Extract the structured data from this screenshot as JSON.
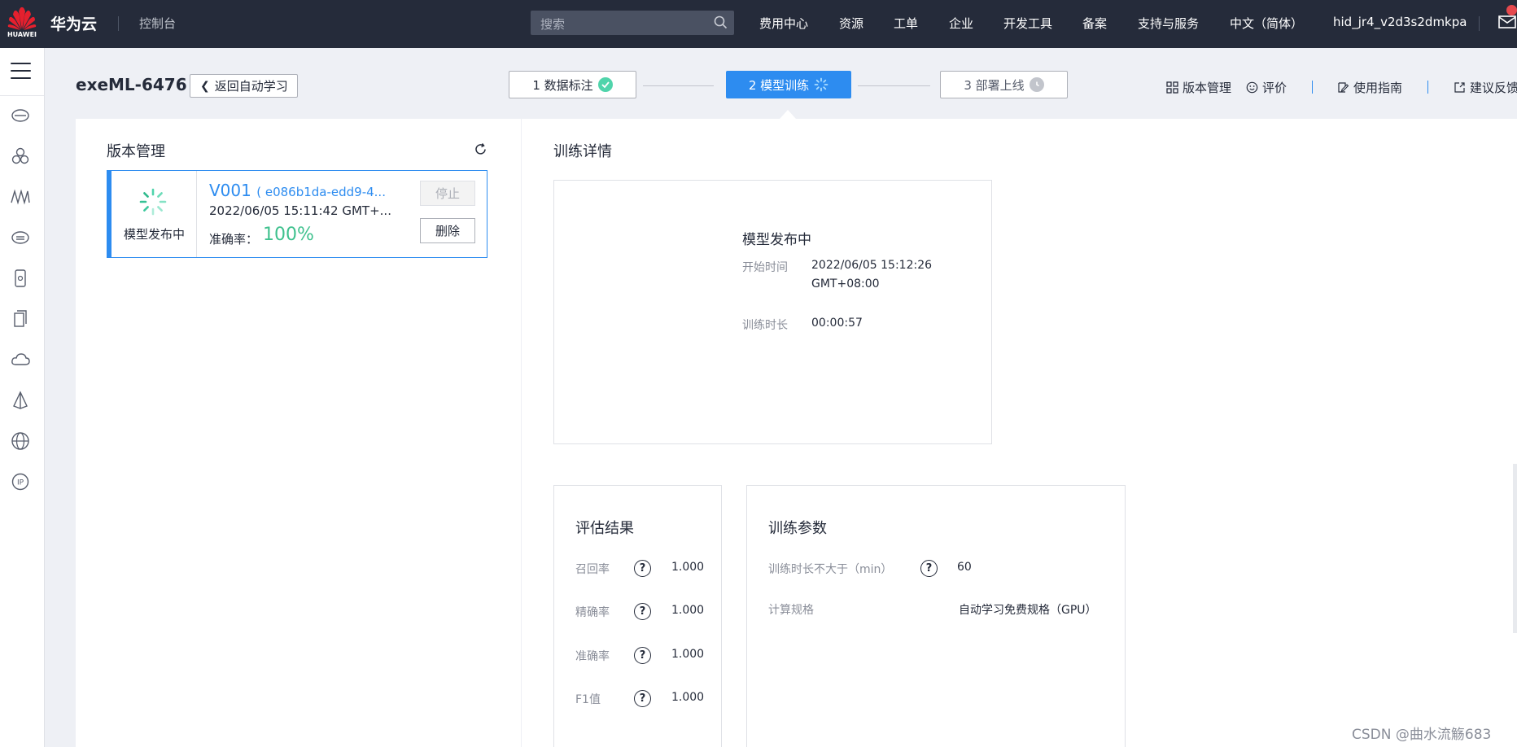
{
  "topbar": {
    "logo_text": "HUAWEI",
    "brand": "华为云",
    "console": "控制台",
    "search_placeholder": "搜索",
    "nav": [
      "费用中心",
      "资源",
      "工单",
      "企业",
      "开发工具",
      "备案",
      "支持与服务",
      "中文（简体）",
      "hid_jr4_v2d3s2dmkpa"
    ]
  },
  "sidebar": {
    "icons": [
      "menu-icon",
      "cloud-server-icon",
      "cluster-icon",
      "network-icon",
      "storage-icon",
      "device-icon",
      "container-icon",
      "cloud-icon",
      "pyramid-icon",
      "globe-icon",
      "ip-icon"
    ]
  },
  "header": {
    "title": "exeML-6476",
    "back_label": "返回自动学习",
    "steps": [
      {
        "label": "1 数据标注",
        "state": "done"
      },
      {
        "label": "2 模型训练",
        "state": "active"
      },
      {
        "label": "3 部署上线",
        "state": "pending"
      }
    ],
    "links": [
      "版本管理",
      "评价",
      "使用指南",
      "建议反馈"
    ]
  },
  "version_panel": {
    "title": "版本管理",
    "card": {
      "status": "模型发布中",
      "version": "V001",
      "id": "( e086b1da-edd9-4...",
      "time": "2022/06/05 15:11:42 GMT+...",
      "accuracy_label": "准确率：",
      "accuracy_value": "100%",
      "stop_label": "停止",
      "delete_label": "删除"
    }
  },
  "detail": {
    "title": "训练详情",
    "status": "模型发布中",
    "start_label": "开始时间",
    "start_value_1": "2022/06/05 15:12:26",
    "start_value_2": "GMT+08:00",
    "duration_label": "训练时长",
    "duration_value": "00:00:57"
  },
  "evaluation": {
    "title": "评估结果",
    "rows": [
      {
        "label": "召回率",
        "value": "1.000"
      },
      {
        "label": "精确率",
        "value": "1.000"
      },
      {
        "label": "准确率",
        "value": "1.000"
      },
      {
        "label": "F1值",
        "value": "1.000"
      }
    ]
  },
  "params": {
    "title": "训练参数",
    "rows": [
      {
        "label": "训练时长不大于（min）",
        "value": "60"
      },
      {
        "label": "计算规格",
        "value": "自动学习免费规格（GPU）"
      }
    ]
  },
  "watermark": "CSDN @曲水流觞683",
  "colors": {
    "primary": "#2d8cf0",
    "success": "#50d4ab",
    "accuracy": "#3fc18e",
    "topbar": "#252b3a"
  }
}
